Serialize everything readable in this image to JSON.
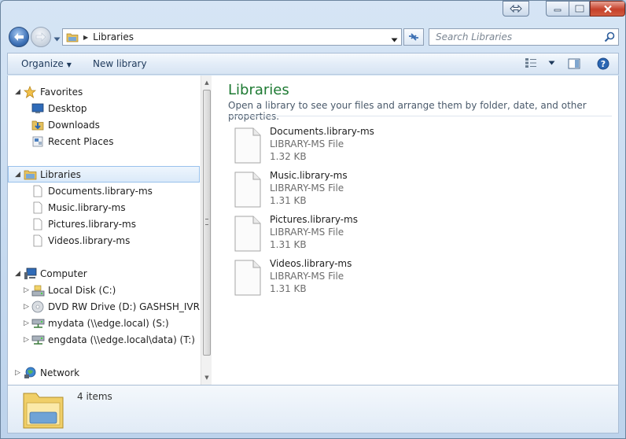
{
  "window": {
    "title": "Libraries"
  },
  "address_bar": {
    "path_label": "Libraries"
  },
  "search": {
    "placeholder": "Search Libraries"
  },
  "toolbar": {
    "organize_label": "Organize",
    "new_library_label": "New library"
  },
  "nav_pane": {
    "favorites": {
      "label": "Favorites",
      "items": [
        {
          "label": "Desktop",
          "icon": "desktop-icon"
        },
        {
          "label": "Downloads",
          "icon": "downloads-icon"
        },
        {
          "label": "Recent Places",
          "icon": "recent-places-icon"
        }
      ]
    },
    "libraries": {
      "label": "Libraries",
      "items": [
        {
          "label": "Documents.library-ms",
          "icon": "file-icon"
        },
        {
          "label": "Music.library-ms",
          "icon": "file-icon"
        },
        {
          "label": "Pictures.library-ms",
          "icon": "file-icon"
        },
        {
          "label": "Videos.library-ms",
          "icon": "file-icon"
        }
      ]
    },
    "computer": {
      "label": "Computer",
      "items": [
        {
          "label": "Local Disk (C:)",
          "icon": "local-disk-icon"
        },
        {
          "label": "DVD RW Drive (D:) GASHSH_IVRI_ZO",
          "icon": "dvd-drive-icon"
        },
        {
          "label": "mydata (\\\\edge.local) (S:)",
          "icon": "network-drive-icon"
        },
        {
          "label": "engdata (\\\\edge.local\\data) (T:)",
          "icon": "network-drive-icon"
        }
      ]
    },
    "network": {
      "label": "Network"
    }
  },
  "main": {
    "title": "Libraries",
    "description": "Open a library to see your files and arrange them by folder, date, and other properties.",
    "files": [
      {
        "name": "Documents.library-ms",
        "type": "LIBRARY-MS File",
        "size": "1.32 KB"
      },
      {
        "name": "Music.library-ms",
        "type": "LIBRARY-MS File",
        "size": "1.31 KB"
      },
      {
        "name": "Pictures.library-ms",
        "type": "LIBRARY-MS File",
        "size": "1.31 KB"
      },
      {
        "name": "Videos.library-ms",
        "type": "LIBRARY-MS File",
        "size": "1.31 KB"
      }
    ]
  },
  "details_pane": {
    "item_count": "4 items"
  },
  "colors": {
    "title_green": "#1e7a33",
    "selection_border": "#99c1ec",
    "chrome_blue": "#c5d9ef"
  }
}
